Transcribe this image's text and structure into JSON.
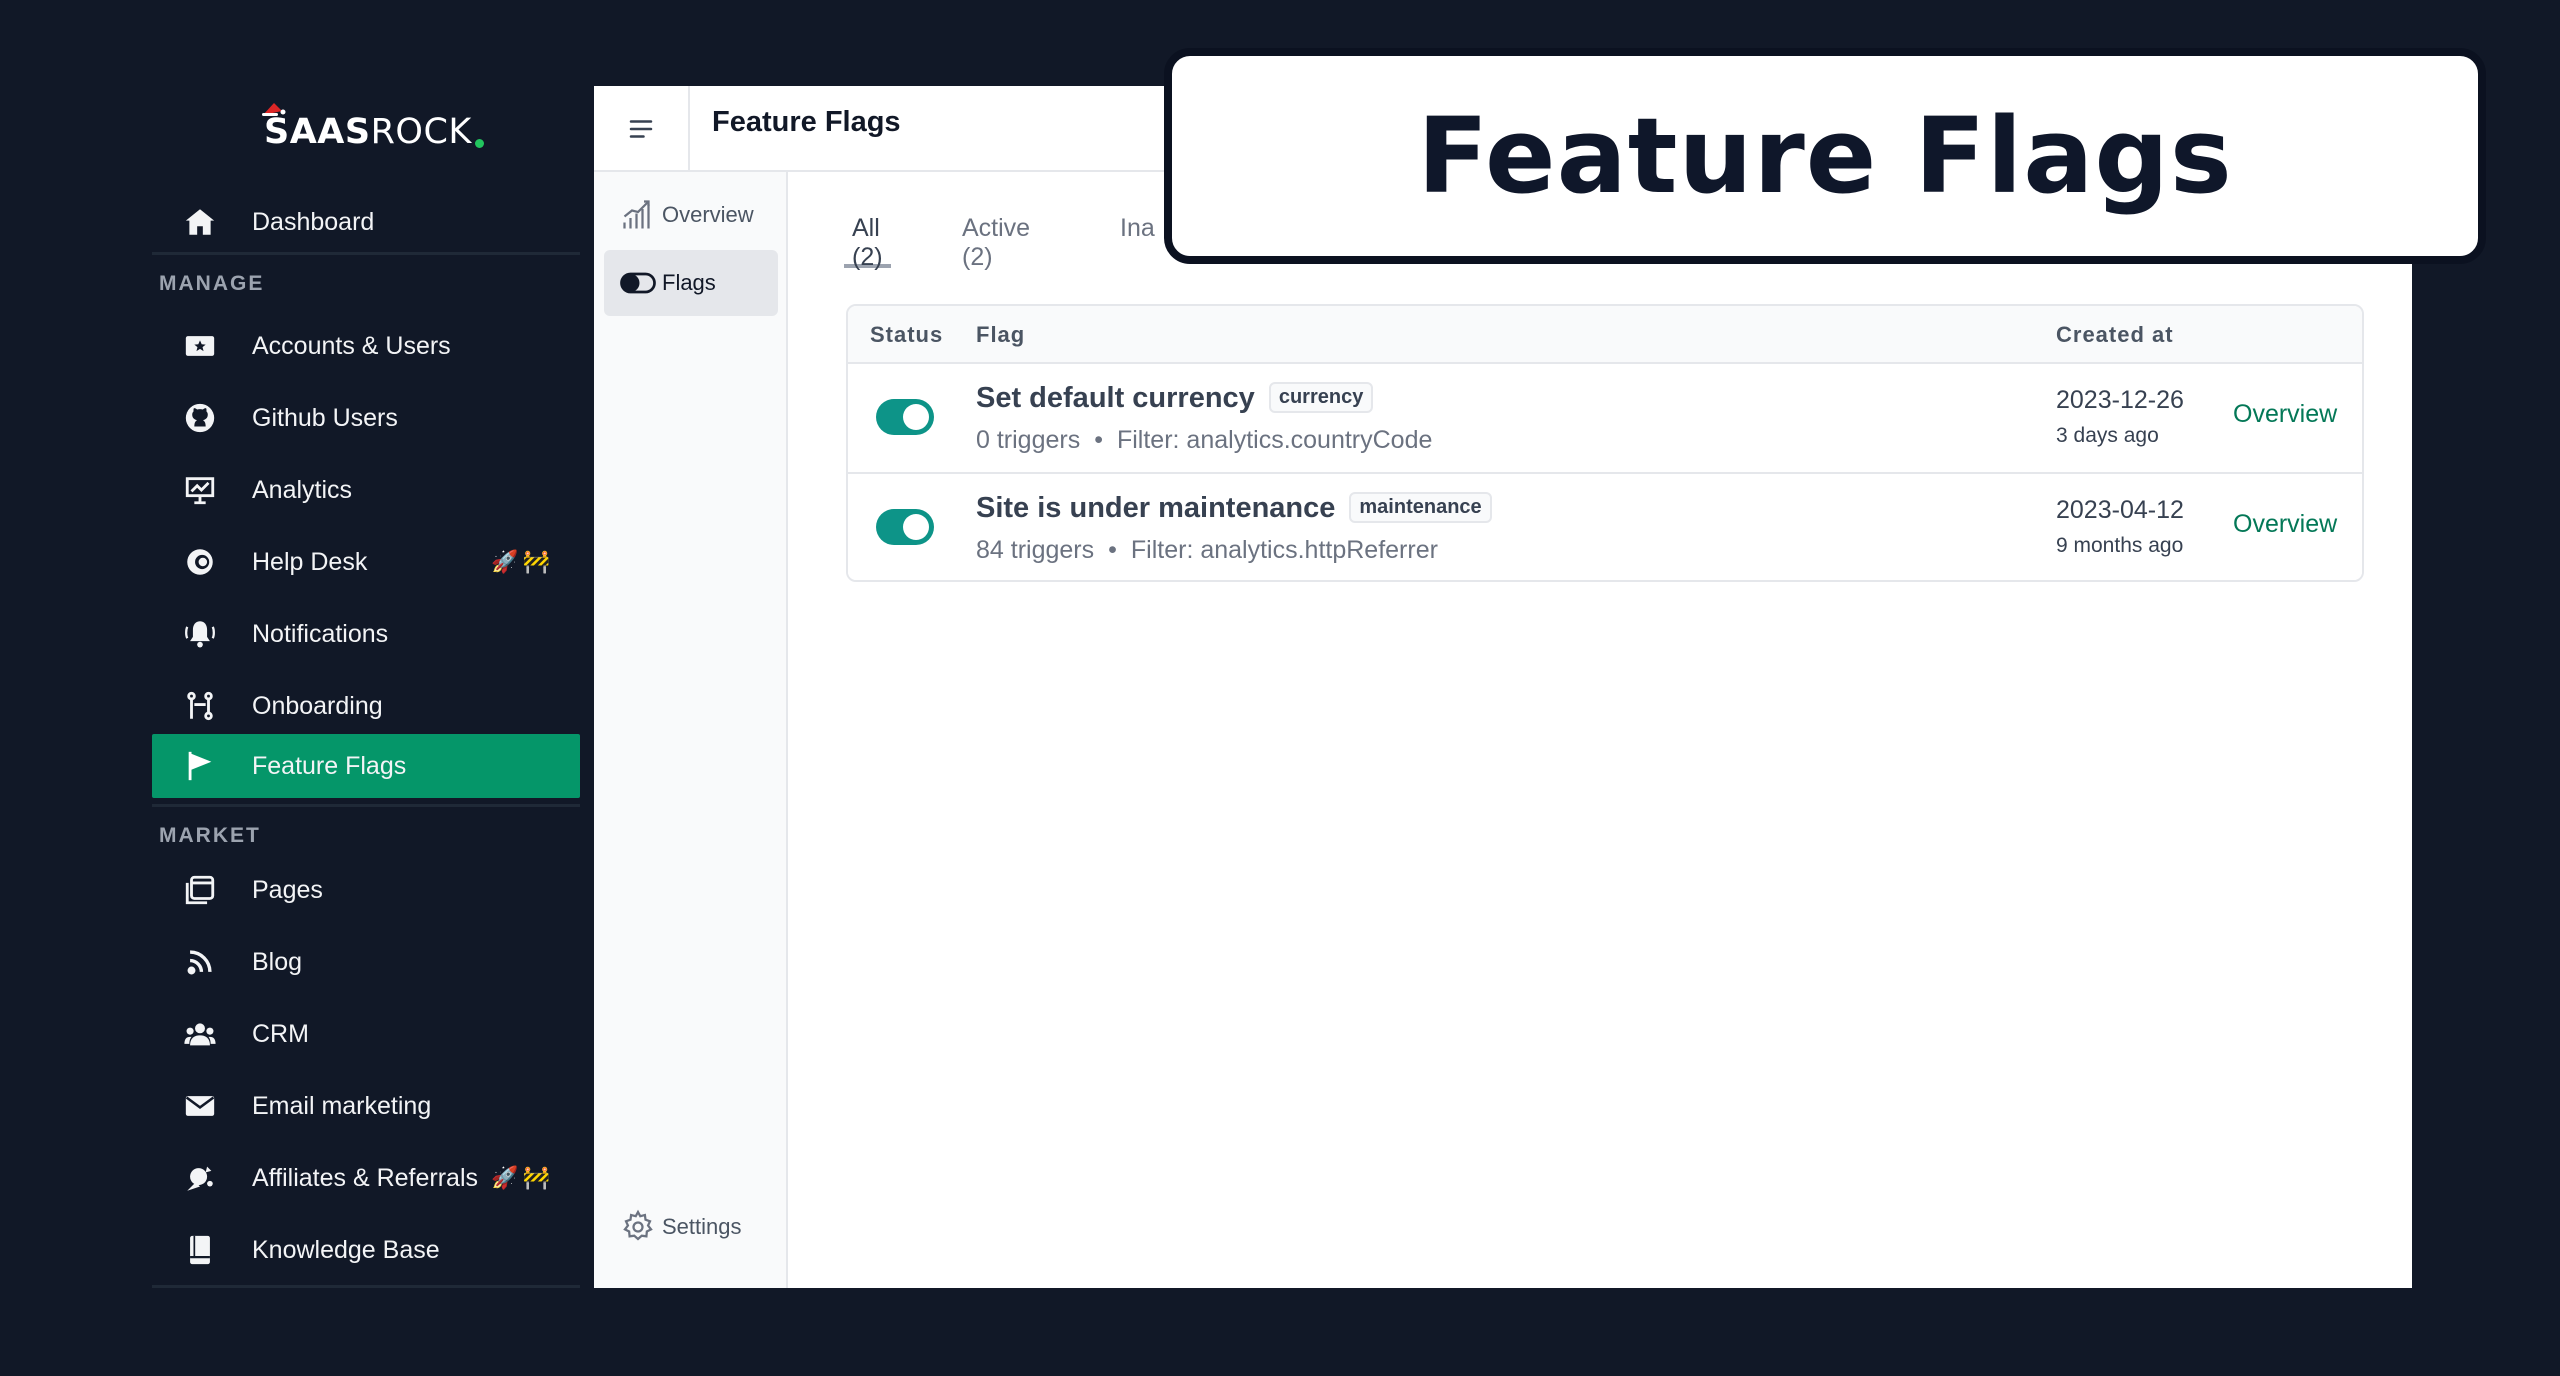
{
  "brand": {
    "name_bold": "SAAS",
    "name_regular": "ROCK",
    "accent_color": "#22c55e"
  },
  "sidebar": {
    "top_items": [
      {
        "label": "Dashboard",
        "icon": "home-icon"
      }
    ],
    "sections": [
      {
        "title": "MANAGE",
        "items": [
          {
            "label": "Accounts & Users",
            "icon": "id-card-star-icon",
            "emoji": ""
          },
          {
            "label": "Github Users",
            "icon": "github-icon",
            "emoji": ""
          },
          {
            "label": "Analytics",
            "icon": "presentation-chart-icon",
            "emoji": ""
          },
          {
            "label": "Help Desk",
            "icon": "help-desk-icon",
            "emoji": "🚀🚧"
          },
          {
            "label": "Notifications",
            "icon": "bell-ringing-icon",
            "emoji": ""
          },
          {
            "label": "Onboarding",
            "icon": "onboarding-flow-icon",
            "emoji": ""
          },
          {
            "label": "Feature Flags",
            "icon": "flag-icon",
            "emoji": "",
            "active": true
          }
        ]
      },
      {
        "title": "MARKET",
        "items": [
          {
            "label": "Pages",
            "icon": "pages-icon",
            "emoji": ""
          },
          {
            "label": "Blog",
            "icon": "rss-icon",
            "emoji": ""
          },
          {
            "label": "CRM",
            "icon": "users-group-icon",
            "emoji": ""
          },
          {
            "label": "Email marketing",
            "icon": "envelope-icon",
            "emoji": ""
          },
          {
            "label": "Affiliates & Referrals",
            "icon": "affiliates-icon",
            "emoji": "🚀🚧"
          },
          {
            "label": "Knowledge Base",
            "icon": "book-icon",
            "emoji": ""
          }
        ]
      }
    ],
    "active_color": "#059669"
  },
  "header": {
    "title": "Feature Flags"
  },
  "subnav": {
    "items": [
      {
        "label": "Overview",
        "icon": "chart-bars-icon"
      },
      {
        "label": "Flags",
        "icon": "toggle-icon",
        "active": true
      }
    ],
    "settings_label": "Settings"
  },
  "tabs": [
    {
      "label": "All (2)",
      "active": true
    },
    {
      "label": "Active (2)"
    },
    {
      "label": "Ina"
    }
  ],
  "table": {
    "headers": {
      "status": "Status",
      "flag": "Flag",
      "created": "Created at"
    },
    "rows": [
      {
        "enabled": true,
        "title": "Set default currency",
        "badge": "currency",
        "triggers": "0 triggers",
        "separator": "•",
        "filter": "Filter: analytics.countryCode",
        "created_date": "2023-12-26",
        "created_ago": "3 days ago",
        "action": "Overview"
      },
      {
        "enabled": true,
        "title": "Site is under maintenance",
        "badge": "maintenance",
        "triggers": "84 triggers",
        "separator": "•",
        "filter": "Filter: analytics.httpReferrer",
        "created_date": "2023-04-12",
        "created_ago": "9 months ago",
        "action": "Overview"
      }
    ],
    "toggle_color": "#0d9488",
    "link_color": "#047857"
  },
  "overlay": {
    "title": "Feature Flags"
  }
}
